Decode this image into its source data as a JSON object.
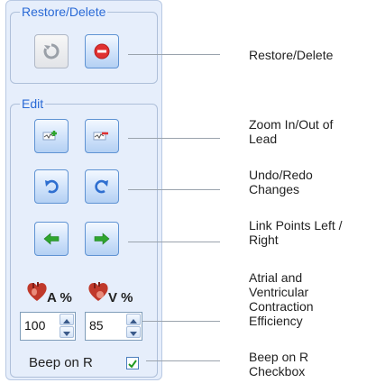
{
  "restore_group": {
    "title": "Restore/Delete"
  },
  "edit_group": {
    "title": "Edit"
  },
  "efficiency": {
    "atrial_label": "A %",
    "ventricular_label": "V %",
    "atrial_value": "100",
    "ventricular_value": "85"
  },
  "beep": {
    "label": "Beep on R",
    "checked": true
  },
  "callouts": {
    "restore_delete": [
      "Restore/Delete"
    ],
    "zoom": [
      "Zoom In/Out of",
      "Lead"
    ],
    "undo_redo": [
      "Undo/Redo",
      "Changes"
    ],
    "link_points": [
      "Link Points Left /",
      "Right"
    ],
    "contraction": [
      "Atrial and",
      "Ventricular",
      "Contraction",
      "Efficiency"
    ],
    "beep": [
      "Beep on R",
      "Checkbox"
    ]
  },
  "colors": {
    "accent": "#2a6ad6",
    "panel_bg": "#e6eefb",
    "delete_red": "#e03131",
    "arrow_green": "#2fa52f",
    "undo_blue": "#2f6fd0"
  }
}
